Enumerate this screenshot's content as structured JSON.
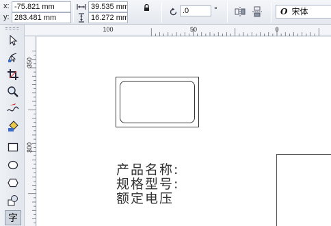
{
  "propbar": {
    "x_label": "x:",
    "x_value": "-75.821 mm",
    "y_label": "y:",
    "y_value": "283.481 mm",
    "width_value": "39.535 mm",
    "height_value": "16.272 mm",
    "rotation_value": ".0",
    "degree_symbol": "°",
    "font_style_glyph": "O",
    "font_name": "宋体"
  },
  "ruler": {
    "h_labels": [
      "100",
      "50",
      "0"
    ],
    "v_labels": [
      "350",
      "300"
    ]
  },
  "canvas": {
    "label_line1": "产品名称:",
    "label_line2": "规格型号:",
    "label_line3": "额定电压"
  },
  "toolbox": {
    "text_tool_glyph": "字"
  }
}
